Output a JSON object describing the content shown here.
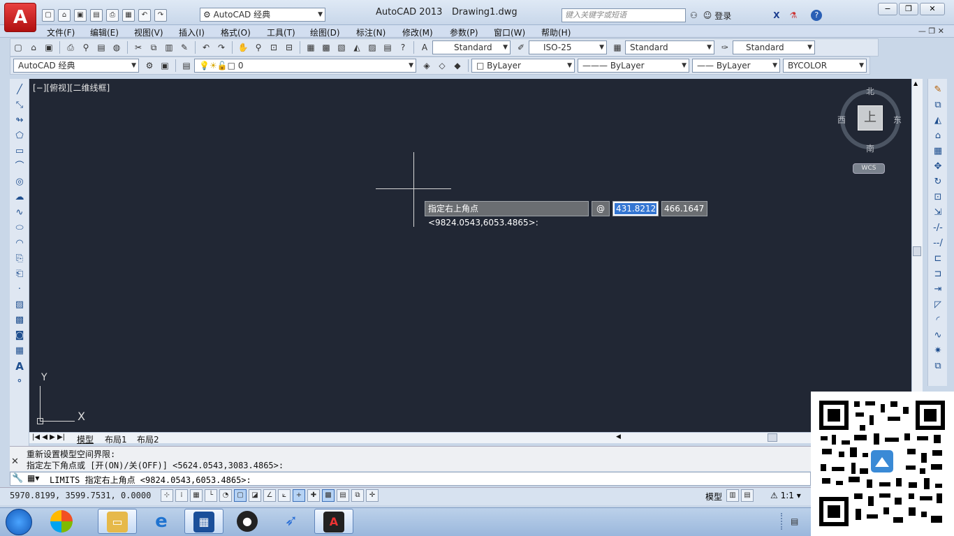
{
  "app": {
    "logo": "A",
    "title": "AutoCAD 2013",
    "document": "Drawing1.dwg"
  },
  "quick_access": {
    "icons": [
      "new-icon",
      "open-icon",
      "save-icon",
      "saveas-icon",
      "plot-icon",
      "print-icon",
      "undo-icon",
      "redo-icon"
    ],
    "workspace": "AutoCAD 经典"
  },
  "search": {
    "placeholder": "键入关键字或短语"
  },
  "account": {
    "login": "登录"
  },
  "window_buttons": {
    "minimize": "−",
    "restore": "❐",
    "close": "✕"
  },
  "menu": [
    "文件(F)",
    "编辑(E)",
    "视图(V)",
    "插入(I)",
    "格式(O)",
    "工具(T)",
    "绘图(D)",
    "标注(N)",
    "修改(M)",
    "参数(P)",
    "窗口(W)",
    "帮助(H)"
  ],
  "styles": {
    "text": "Standard",
    "dim": "ISO-25",
    "table": "Standard",
    "multileader": "Standard"
  },
  "layer": {
    "workspace": "AutoCAD 经典",
    "current": "0",
    "color": "ByLayer",
    "linetype": "ByLayer",
    "lineweight": "ByLayer",
    "plotstyle": "BYCOLOR"
  },
  "viewport": {
    "label": "[−][俯视][二维线框]"
  },
  "dynamic_input": {
    "prompt": "指定右上角点 <9824.0543,6053.4865>:",
    "at": "@",
    "x": "431.8212",
    "y": "466.1647"
  },
  "viewcube": {
    "north": "北",
    "south": "南",
    "east": "东",
    "west": "西",
    "face": "上",
    "wcs": "WCS"
  },
  "ucs": {
    "x": "X",
    "y": "Y"
  },
  "tabs": [
    "模型",
    "布局1",
    "布局2"
  ],
  "command": {
    "history": [
      "重新设置模型空间界限:",
      "指定左下角点或 [开(ON)/关(OFF)] <5624.0543,3083.4865>:"
    ],
    "input": "LIMITS 指定右上角点 <9824.0543,6053.4865>:"
  },
  "status": {
    "coords": "5970.8199, 3599.7531, 0.0000",
    "model": "模型",
    "scale": "1:1"
  },
  "taskbar": [
    "explorer",
    "ie",
    "media",
    "qq",
    "feishu",
    "autocad"
  ]
}
